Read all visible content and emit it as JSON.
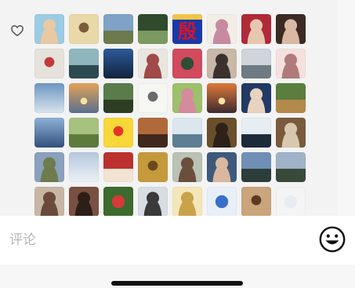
{
  "icons": {
    "like": "heart-outline-icon",
    "emoji": "smiley-face-icon"
  },
  "comment": {
    "placeholder": "评论"
  },
  "colors": {
    "panel_background": "#f3f3f3",
    "icon_stroke": "#555555",
    "home_indicator": "#111111"
  },
  "avatar_glyph": "殷",
  "avatars": [
    {
      "c1": "#9ccbe4",
      "c2": "#e8c9a3",
      "kind": "portrait"
    },
    {
      "c1": "#e9d9a8",
      "c2": "#7a5b3c",
      "kind": "cartoon"
    },
    {
      "c1": "#7ea3c6",
      "c2": "#6c7a4d",
      "kind": "landscape"
    },
    {
      "c1": "#2f4a2c",
      "c2": "#7a9a62",
      "kind": "landscape"
    },
    {
      "c1": "#1a3aa8",
      "c2": "#d32b2b",
      "kind": "glyph"
    },
    {
      "c1": "#f2eee6",
      "c2": "#c88aa0",
      "kind": "portrait"
    },
    {
      "c1": "#b02a3a",
      "c2": "#e8c7b0",
      "kind": "portrait"
    },
    {
      "c1": "#3b2b24",
      "c2": "#d9b9a3",
      "kind": "portrait"
    },
    {
      "c1": "#e4e2db",
      "c2": "#c23a3a",
      "kind": "cartoon"
    },
    {
      "c1": "#8fb6bf",
      "c2": "#2d4a52",
      "kind": "landscape"
    },
    {
      "c1": "#2d5a9a",
      "c2": "#11233d",
      "kind": "sky"
    },
    {
      "c1": "#e9e6e1",
      "c2": "#a14a4a",
      "kind": "portrait"
    },
    {
      "c1": "#2f4d33",
      "c2": "#d14a5e",
      "kind": "flower"
    },
    {
      "c1": "#c9b8a8",
      "c2": "#3b3230",
      "kind": "portrait"
    },
    {
      "c1": "#cfd5da",
      "c2": "#6e7b84",
      "kind": "landscape"
    },
    {
      "c1": "#f4e1de",
      "c2": "#b17a7a",
      "kind": "portrait"
    },
    {
      "c1": "#6c96c2",
      "c2": "#d9e3ec",
      "kind": "sky"
    },
    {
      "c1": "#e3a256",
      "c2": "#5a6f8f",
      "kind": "sunset"
    },
    {
      "c1": "#5a7b4a",
      "c2": "#2c3d22",
      "kind": "landscape"
    },
    {
      "c1": "#f6f6f2",
      "c2": "#6b6b6b",
      "kind": "cartoon"
    },
    {
      "c1": "#9cc16a",
      "c2": "#d48b9c",
      "kind": "portrait"
    },
    {
      "c1": "#e07a3a",
      "c2": "#3d2a30",
      "kind": "sunset"
    },
    {
      "c1": "#233a66",
      "c2": "#e8d3c0",
      "kind": "portrait"
    },
    {
      "c1": "#5b7d3e",
      "c2": "#b4894c",
      "kind": "landscape"
    },
    {
      "c1": "#8fb1d6",
      "c2": "#31507c",
      "kind": "sky"
    },
    {
      "c1": "#a7c27e",
      "c2": "#5d7c3c",
      "kind": "landscape"
    },
    {
      "c1": "#f7d838",
      "c2": "#e4352a",
      "kind": "cartoon"
    },
    {
      "c1": "#b06a3a",
      "c2": "#40281c",
      "kind": "landscape"
    },
    {
      "c1": "#dce6ee",
      "c2": "#5e7f93",
      "kind": "landscape"
    },
    {
      "c1": "#6a4f2c",
      "c2": "#2d2118",
      "kind": "portrait"
    },
    {
      "c1": "#e6edf3",
      "c2": "#1d2a3a",
      "kind": "landscape"
    },
    {
      "c1": "#7a5a3c",
      "c2": "#d9c8b0",
      "kind": "portrait"
    },
    {
      "c1": "#8aa0bd",
      "c2": "#6d7b4d",
      "kind": "portrait"
    },
    {
      "c1": "#b5c7dc",
      "c2": "#edf1f6",
      "kind": "sky"
    },
    {
      "c1": "#bd3030",
      "c2": "#f3e3d3",
      "kind": "landscape"
    },
    {
      "c1": "#c59a3d",
      "c2": "#6b4a1e",
      "kind": "cartoon"
    },
    {
      "c1": "#b9c2b4",
      "c2": "#6b4e3e",
      "kind": "portrait"
    },
    {
      "c1": "#3d5a7a",
      "c2": "#d9b89f",
      "kind": "portrait"
    },
    {
      "c1": "#6f8fb6",
      "c2": "#2d3d3a",
      "kind": "landscape"
    },
    {
      "c1": "#9fb2c7",
      "c2": "#3a4a3a",
      "kind": "landscape"
    },
    {
      "c1": "#c7b6a4",
      "c2": "#6a4a3a",
      "kind": "portrait"
    },
    {
      "c1": "#7a5042",
      "c2": "#2e1e18",
      "kind": "portrait"
    },
    {
      "c1": "#d63a3a",
      "c2": "#3d6a2d",
      "kind": "flower"
    },
    {
      "c1": "#d8dde3",
      "c2": "#3a3a3a",
      "kind": "portrait"
    },
    {
      "c1": "#f4e6b8",
      "c2": "#c9a24a",
      "kind": "portrait"
    },
    {
      "c1": "#3a6fc9",
      "c2": "#e9eff8",
      "kind": "flower"
    },
    {
      "c1": "#caa47a",
      "c2": "#5a3a22",
      "kind": "cartoon"
    },
    {
      "c1": "#e8ecf0",
      "c2": "#f4f4f4",
      "kind": "flower"
    }
  ]
}
